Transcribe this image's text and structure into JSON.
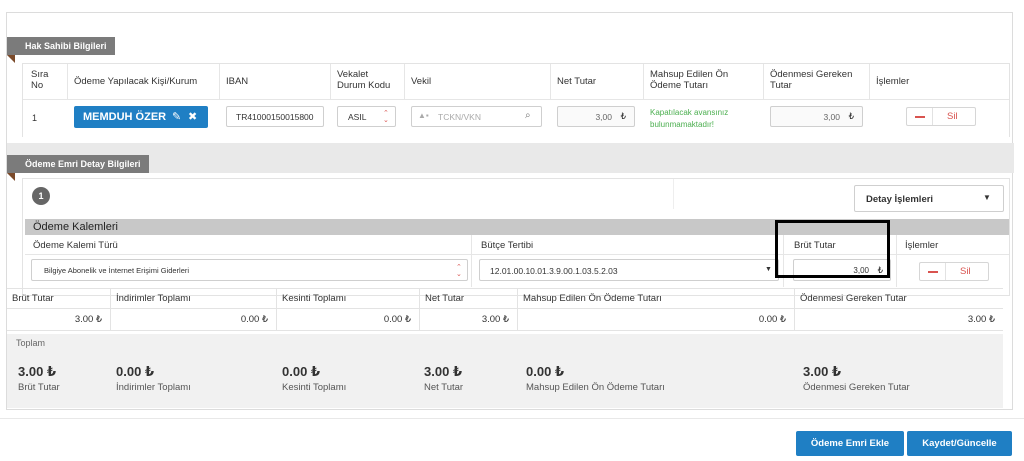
{
  "section1": {
    "title": "Hak Sahibi Bilgileri",
    "columns": {
      "sira": "Sıra No",
      "kisi": "Ödeme Yapılacak Kişi/Kurum",
      "iban": "IBAN",
      "vekalet": "Vekalet Durum Kodu",
      "vekil": "Vekil",
      "net": "Net Tutar",
      "mahsup": "Mahsup Edilen Ön Ödeme Tutarı",
      "odenmesi": "Ödenmesi Gereken Tutar",
      "islemler": "İşlemler"
    },
    "row": {
      "sira": "1",
      "kisi": "MEMDUH ÖZER",
      "iban": "TR41000150015800",
      "vekalet": "ASIL",
      "vekil_placeholder": "TCKN/VKN",
      "net": "3,00",
      "mahsup_note": "Kapatılacak avansınız bulunmamaktadır!",
      "odenmesi": "3,00",
      "sil": "Sil"
    }
  },
  "section2": {
    "title": "Ödeme Emri Detay Bilgileri",
    "index": "1",
    "detay_button": "Detay İşlemleri",
    "kalemler_title": "Ödeme Kalemleri",
    "cols": {
      "tur": "Ödeme Kalemi Türü",
      "butce": "Bütçe Tertibi",
      "brut": "Brüt Tutar",
      "islemler": "İşlemler"
    },
    "row": {
      "tur": "Bilgiye Abonelik ve İnternet Erişimi Giderleri",
      "butce": "12.01.00.10.01.3.9.00.1.03.5.2.03",
      "brut": "3,00",
      "sil": "Sil"
    }
  },
  "summary": {
    "headers": [
      "Brüt Tutar",
      "İndirimler Toplamı",
      "Kesinti Toplamı",
      "Net Tutar",
      "Mahsup Edilen Ön Ödeme Tutarı",
      "Ödenmesi Gereken Tutar"
    ],
    "values": [
      "3.00",
      "0.00",
      "0.00",
      "3.00",
      "0.00",
      "3.00"
    ]
  },
  "totals": {
    "label": "Toplam",
    "items": [
      {
        "value": "3.00",
        "label": "Brüt Tutar"
      },
      {
        "value": "0.00",
        "label": "İndirimler Toplamı"
      },
      {
        "value": "0.00",
        "label": "Kesinti Toplamı"
      },
      {
        "value": "3.00",
        "label": "Net Tutar"
      },
      {
        "value": "0.00",
        "label": "Mahsup Edilen Ön Ödeme Tutarı"
      },
      {
        "value": "3.00",
        "label": "Ödenmesi Gereken Tutar"
      }
    ]
  },
  "currency": "₺",
  "footer": {
    "odeme_emri_ekle": "Ödeme Emri Ekle",
    "kaydet": "Kaydet/Güncelle"
  },
  "colors": {
    "primary": "#1f7fc4",
    "danger": "#d9534f",
    "green_note": "#4caf50",
    "tag_grey": "#7b7b7b",
    "tag_notch": "#7b4a2a"
  }
}
